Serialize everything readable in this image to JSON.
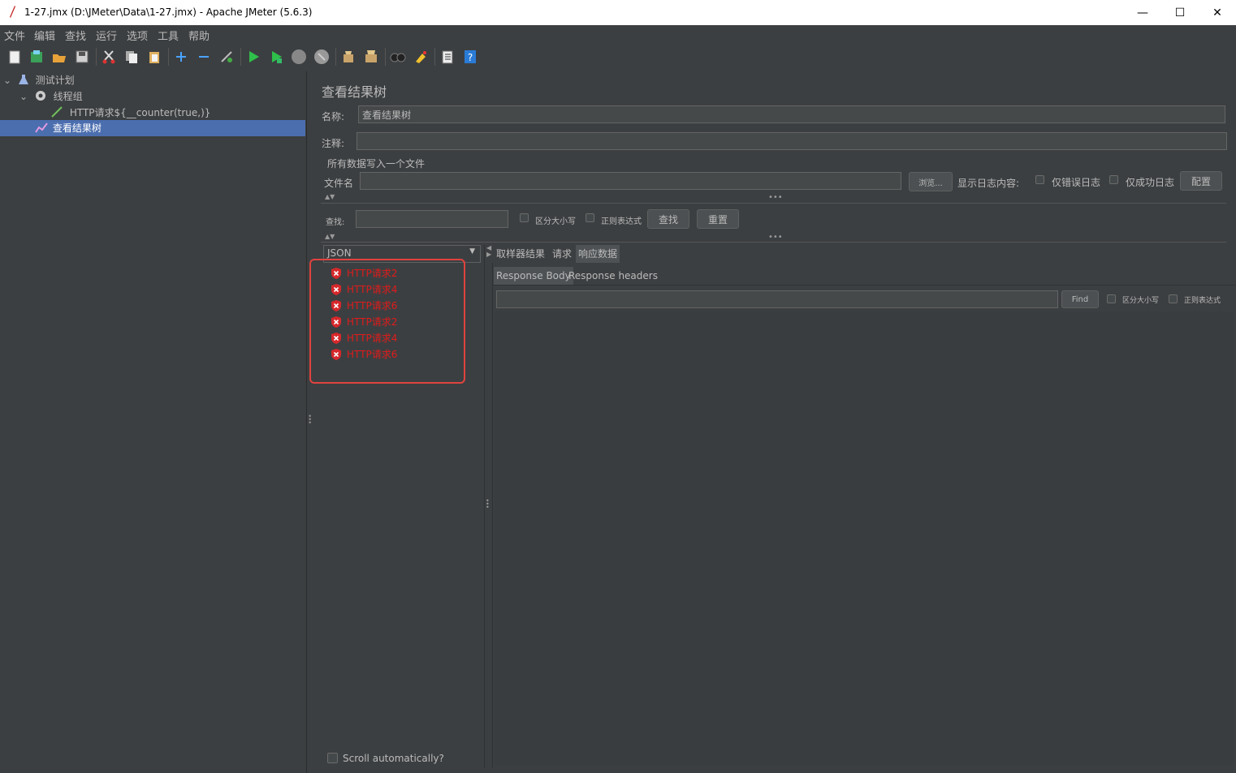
{
  "window": {
    "title": "1-27.jmx (D:\\JMeter\\Data\\1-27.jmx) - Apache JMeter (5.6.3)",
    "minimize": "—",
    "maximize": "☐",
    "close": "✕"
  },
  "menu": [
    "文件",
    "编辑",
    "查找",
    "运行",
    "选项",
    "工具",
    "帮助"
  ],
  "toolbar_icons": [
    "new-icon",
    "templates-icon",
    "open-icon",
    "save-icon",
    "cut-icon",
    "copy-icon",
    "paste-icon",
    "expand-icon",
    "collapse-icon",
    "toggle-icon",
    "start-icon",
    "start-no-pause-icon",
    "stop-icon",
    "shutdown-icon",
    "clear-icon",
    "clear-all-icon",
    "search-icon",
    "reset-search-icon",
    "function-helper-icon",
    "help-icon"
  ],
  "tree": {
    "plan": "测试计划",
    "thread_group": "线程组",
    "http_request": "HTTP请求${__counter(true,)}",
    "listener": "查看结果树"
  },
  "panel": {
    "title": "查看结果树",
    "name_label": "名称:",
    "name_value": "查看结果树",
    "comment_label": "注释:",
    "comment_value": "",
    "file_group_title": "所有数据写入一个文件",
    "filename_label": "文件名",
    "filename_value": "",
    "browse_button": "浏览...",
    "log_label": "显示日志内容:",
    "errors_only": "仅错误日志",
    "success_only": "仅成功日志",
    "config_button": "配置",
    "search_label": "查找:",
    "search_value": "",
    "case_sensitive": "区分大小写",
    "regex": "正则表达式",
    "find_button": "查找",
    "reset_button": "重置",
    "renderer": "JSON",
    "results": [
      "HTTP请求2",
      "HTTP请求4",
      "HTTP请求6",
      "HTTP请求2",
      "HTTP请求4",
      "HTTP请求6"
    ],
    "scroll_auto": "Scroll automatically?",
    "tabs": [
      "取样器结果",
      "请求",
      "响应数据"
    ],
    "active_tab": "响应数据",
    "subtabs": [
      "Response Body",
      "Response headers"
    ],
    "active_subtab": "Response Body",
    "find_small_button": "Find",
    "case_sensitive_small": "区分大小写",
    "regex_small": "正则表达式",
    "response_search_value": ""
  },
  "colors": {
    "background": "#3c3f41",
    "selection": "#4b6eaf",
    "error_text": "#e01b1b",
    "highlight_box": "#e0433f"
  }
}
